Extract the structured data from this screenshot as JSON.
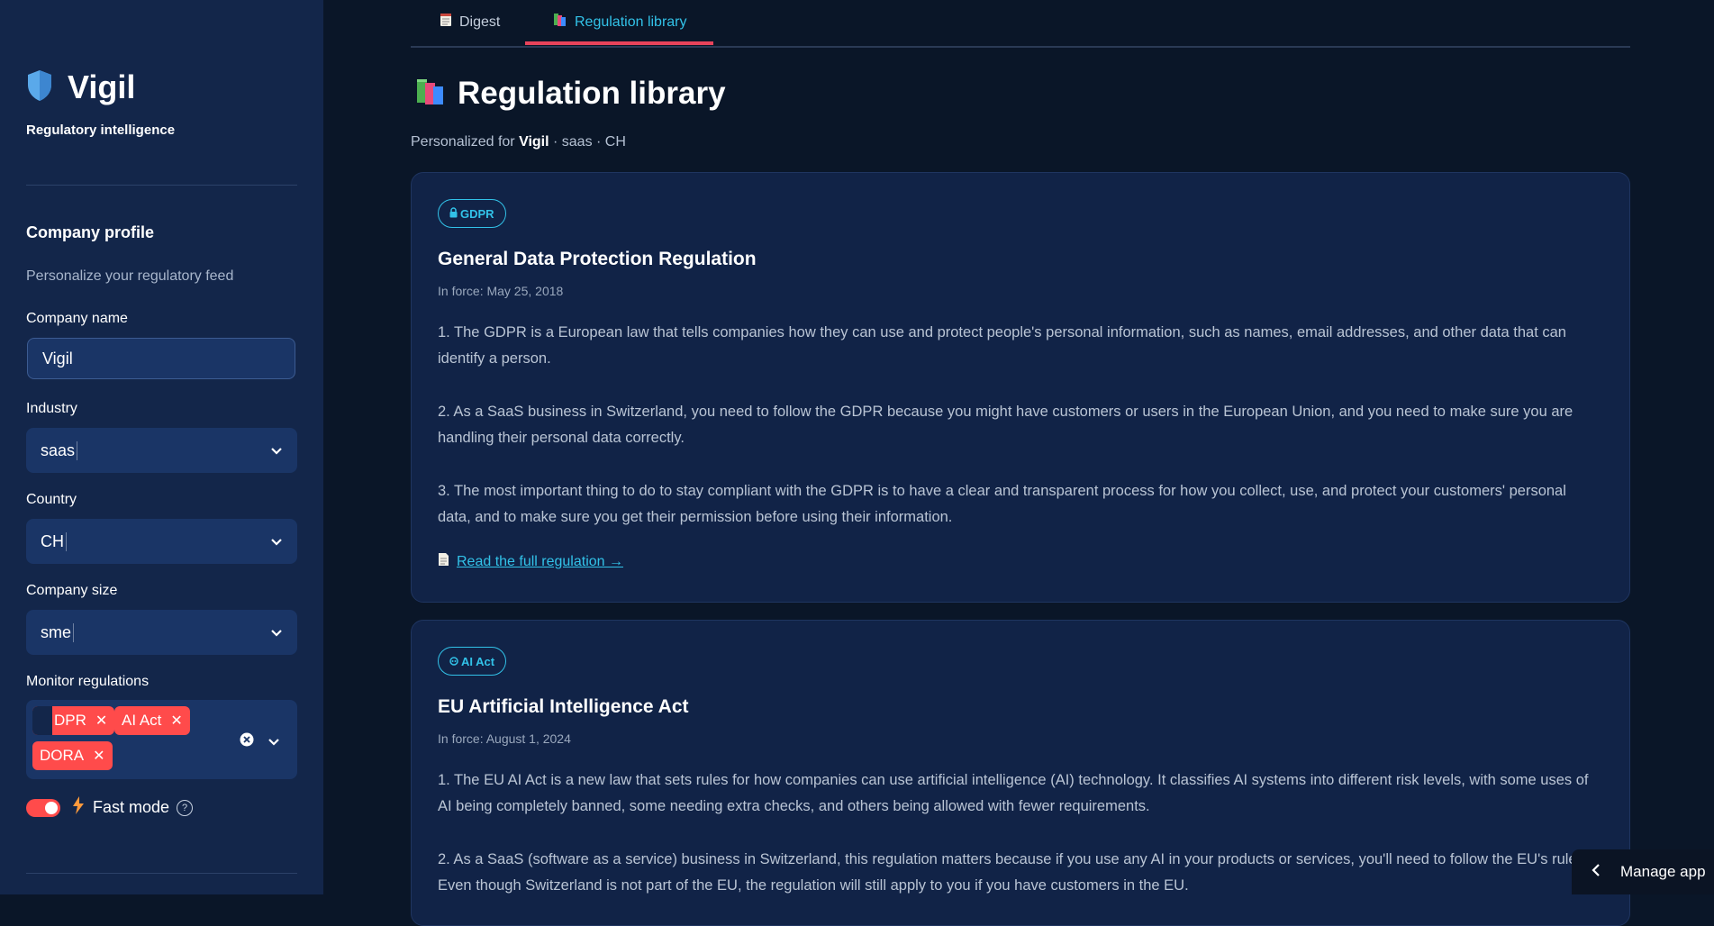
{
  "sidebar": {
    "brand": {
      "name": "Vigil",
      "subtitle": "Regulatory intelligence",
      "icon": "shield-icon"
    },
    "section_title": "Company profile",
    "section_caption": "Personalize your regulatory feed",
    "fields": {
      "company_name": {
        "label": "Company name",
        "value": "Vigil"
      },
      "industry": {
        "label": "Industry",
        "value": "saas"
      },
      "country": {
        "label": "Country",
        "value": "CH"
      },
      "company_size": {
        "label": "Company size",
        "value": "sme"
      },
      "monitor": {
        "label": "Monitor regulations",
        "tags": [
          "GDPR",
          "AI Act",
          "DORA"
        ],
        "first_tag_visible_text": "DPR"
      }
    },
    "fast_mode": {
      "label": "Fast mode",
      "enabled": true
    }
  },
  "tabs": [
    {
      "label": "Digest",
      "icon": "notepad-icon",
      "active": false
    },
    {
      "label": "Regulation library",
      "icon": "books-icon",
      "active": true
    }
  ],
  "page": {
    "title": "Regulation library",
    "personalized": {
      "prefix": "Personalized for ",
      "company": "Vigil",
      "suffix": " · saas · CH"
    }
  },
  "regulations": [
    {
      "badge": "GDPR",
      "badge_icon": "lock-icon",
      "title": "General Data Protection Regulation",
      "in_force": "In force: May 25, 2018",
      "points": [
        "1. The GDPR is a European law that tells companies how they can use and protect people's personal information, such as names, email addresses, and other data that can identify a person.",
        "2. As a SaaS business in Switzerland, you need to follow the GDPR because you might have customers or users in the European Union, and you need to make sure you are handling their personal data correctly.",
        "3. The most important thing to do to stay compliant with the GDPR is to have a clear and transparent process for how you collect, use, and protect your customers' personal data, and to make sure you get their permission before using their information."
      ],
      "link": "Read the full regulation →"
    },
    {
      "badge": "AI Act",
      "badge_icon": "robot-icon",
      "title": "EU Artificial Intelligence Act",
      "in_force": "In force: August 1, 2024",
      "points": [
        "1. The EU AI Act is a new law that sets rules for how companies can use artificial intelligence (AI) technology. It classifies AI systems into different risk levels, with some uses of AI being completely banned, some needing extra checks, and others being allowed with fewer requirements.",
        "2. As a SaaS (software as a service) business in Switzerland, this regulation matters because if you use any AI in your products or services, you'll need to follow the EU's rules. Even though Switzerland is not part of the EU, the regulation will still apply to you if you have customers in the EU."
      ]
    }
  ],
  "manage_app": "Manage app",
  "colors": {
    "sidebar_bg": "#13264a",
    "main_bg": "#0a1628",
    "card_bg": "#112347",
    "accent_cyan": "#32c2e8",
    "tag_red": "#ff4b4b",
    "tab_underline": "#e8435a"
  }
}
